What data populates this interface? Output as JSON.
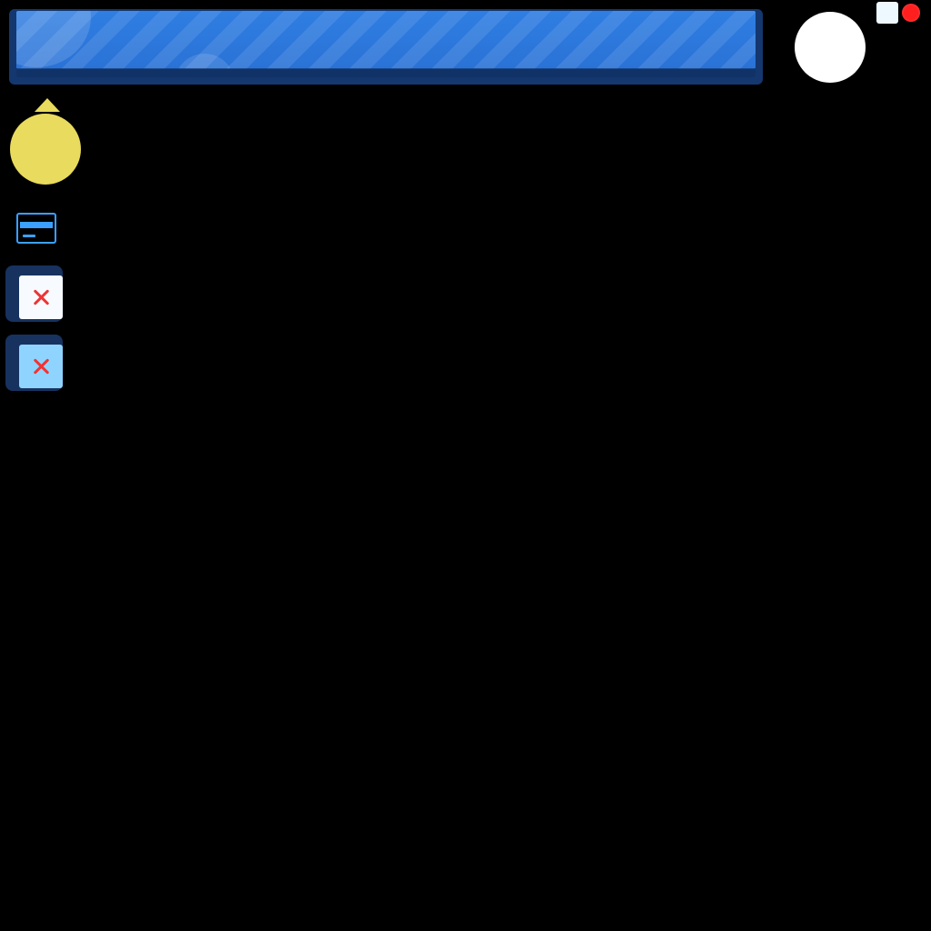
{
  "theme": {
    "background": "#000000",
    "banner_outer": "#14376f",
    "banner_fill": "#2f7ee2",
    "white": "#ffffff",
    "yellow": "#e9db5d",
    "card_blue": "#3ba0ff",
    "tile_dark": "#17325f",
    "tile_light": "#f7fbff",
    "tile_blue": "#8fd4ff",
    "close_red": "#ef3434",
    "small_square": "#eef8ff",
    "small_red": "#ff1f1f"
  },
  "elements": {
    "top_banner": "top-banner",
    "profile_disc": "white-disc",
    "notification_square": "small-square",
    "status_dot": "red-status-dot",
    "coin_orb": "yellow-orb",
    "card_icon": "card-icon",
    "tiles": [
      {
        "name": "tile-light-close",
        "face": "light",
        "icon": "close-icon"
      },
      {
        "name": "tile-blue-close",
        "face": "blue",
        "icon": "close-icon"
      }
    ]
  }
}
